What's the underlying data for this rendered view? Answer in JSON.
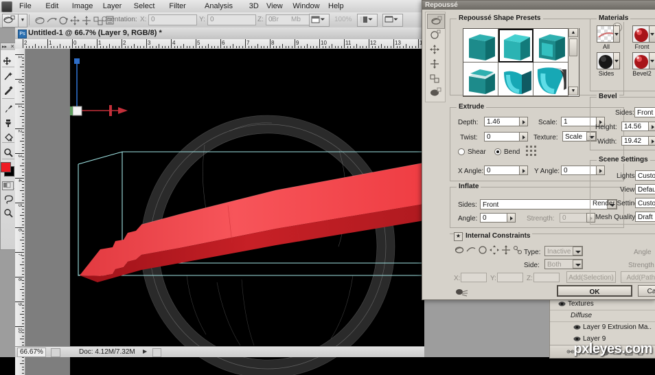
{
  "menubar": {
    "logo_icon": "photoshop-logo-icon",
    "items": [
      "File",
      "Edit",
      "Image",
      "Layer",
      "Select",
      "Filter",
      "Analysis",
      "3D",
      "View",
      "Window",
      "Help"
    ],
    "right_controls": [
      "bridge-icon",
      "minibridge-icon"
    ]
  },
  "options_bar": {
    "tool_icon": "3d-object-rotate-tool-icon",
    "tool_caret": "▼",
    "mode_icons": [
      "3d-rotate-icon",
      "3d-roll-icon",
      "3d-pan-icon",
      "3d-slide-icon",
      "3d-scale-icon",
      "3d-mesh-icon"
    ],
    "orientation_label": "Orientation:",
    "x_label": "X:",
    "x_value": "0",
    "y_label": "Y:",
    "y_value": "0",
    "z_label": "Z:",
    "z_value": "0",
    "right_icons": [
      "doc-arrange-icon",
      "screen-mode-icon",
      "extras-icon"
    ],
    "right_zoom": "100%",
    "right_gray_labels": [
      "Br",
      "Mb"
    ]
  },
  "toolbox": {
    "collapse_icon": "▸▸",
    "close_icon": "✕",
    "tools": [
      {
        "name": "move-tool",
        "icon": "move-icon"
      },
      {
        "name": "magic-wand-tool",
        "icon": "magic-wand-icon"
      },
      {
        "name": "eyedropper-tool",
        "icon": "eyedropper-icon"
      },
      {
        "name": "brush-tool",
        "icon": "brush-icon"
      },
      {
        "name": "clone-stamp-tool",
        "icon": "clone-stamp-icon"
      },
      {
        "name": "paint-bucket-tool",
        "icon": "paint-bucket-icon"
      },
      {
        "name": "dodge-burn-tool",
        "icon": "burn-icon"
      },
      {
        "name": "type-tool",
        "icon": "type-t-icon"
      },
      {
        "name": "shape-tool",
        "icon": "rectangle-shape-icon"
      },
      {
        "name": "lasso-tool",
        "icon": "lasso-icon"
      },
      {
        "name": "zoom-tool",
        "icon": "magnifier-icon"
      }
    ],
    "foreground_color": "#ee1b24",
    "background_color": "#000000",
    "quickmask_icon": "quick-mask-icon"
  },
  "document": {
    "badge": "Ps",
    "title": "Untitled-1 @ 66.7% (Layer 9, RGB/8) *",
    "ruler_h_marks": [
      "2",
      "1",
      "0",
      "1",
      "2",
      "3",
      "4",
      "5",
      "6",
      "7",
      "8",
      "9",
      "10",
      "11",
      "12",
      "13",
      "14"
    ],
    "ruler_v_marks": [
      "1",
      "0",
      "1",
      "2",
      "3",
      "4",
      "5",
      "6",
      "7",
      "8",
      "9",
      "10",
      "11"
    ],
    "canvas_background": "#000000",
    "artwork": {
      "bounding_box_color": "#9fe3e3",
      "extrusion_color_light": "#f4454a",
      "extrusion_color_dark": "#a5151c",
      "ring_color": "#232323",
      "axis_y_color": "#2e6ec9",
      "axis_x_color": "#c4303a"
    }
  },
  "status_bar": {
    "zoom": "66.67%",
    "doc_icon": "doc-preview-icon",
    "doc_info": "Doc: 4.12M/7.32M",
    "arrow": "▶"
  },
  "dialog": {
    "title": "Repoussé",
    "side_tools": [
      {
        "name": "repousse-mesh-tool",
        "icon": "mesh-rotate-icon",
        "selected": true
      },
      {
        "name": "repousse-roll-tool",
        "icon": "roll-icon",
        "selected": false
      },
      {
        "name": "repousse-pan-tool",
        "icon": "pan-icon",
        "selected": false
      },
      {
        "name": "repousse-slide-tool",
        "icon": "slide-icon",
        "selected": false
      },
      {
        "name": "repousse-scale-tool",
        "icon": "scale-icon",
        "selected": false
      },
      {
        "name": "repousse-camera-tool",
        "icon": "camera-icon",
        "selected": false
      }
    ],
    "presets": {
      "group_label": "Repoussé Shape Presets",
      "flyout_icon": "flyout-menu-icon",
      "items": [
        {
          "name": "preset-bevel-none",
          "selected": false
        },
        {
          "name": "preset-inflate-front",
          "selected": true
        },
        {
          "name": "preset-inflate-sides",
          "selected": false
        },
        {
          "name": "preset-bevel-ring",
          "selected": false
        },
        {
          "name": "preset-cone-short",
          "selected": false
        },
        {
          "name": "preset-cone-twist",
          "selected": false
        }
      ],
      "scroll_up": "▲",
      "scroll_down": "▼"
    },
    "extrude": {
      "group_label": "Extrude",
      "depth_label": "Depth:",
      "depth_value": "1.46",
      "scale_label": "Scale:",
      "scale_value": "1",
      "twist_label": "Twist:",
      "twist_value": "0",
      "texture_label": "Texture:",
      "texture_value": "Scale",
      "shear_label": "Shear",
      "bend_label": "Bend",
      "bend_selected": true,
      "constraint_icon": "bend-grid-icon",
      "x_angle_label": "X Angle:",
      "x_angle_value": "0",
      "y_angle_label": "Y Angle:",
      "y_angle_value": "0"
    },
    "inflate": {
      "group_label": "Inflate",
      "sides_label": "Sides:",
      "sides_value": "Front",
      "angle_label": "Angle:",
      "angle_value": "0",
      "strength_label": "Strength:",
      "strength_value": "0",
      "strength_disabled": true
    },
    "internal_constraints": {
      "group_label": "Internal Constraints",
      "expand_icon": "expand-collapse-icon",
      "tool_icons": [
        "constraint-rotate-icon",
        "constraint-roll-icon",
        "constraint-pan-icon",
        "constraint-slide-icon",
        "constraint-scale-icon",
        "constraint-mesh-icon"
      ],
      "type_label": "Type:",
      "type_value": "Inactive",
      "side_label": "Side:",
      "side_value": "Both",
      "angle_label": "Angle",
      "strength_label": "Strength",
      "x_label": "X:",
      "x_value": "",
      "y_label": "Y:",
      "y_value": "",
      "z_label": "Z:",
      "z_value": "",
      "add_selection_label": "Add(Selection)",
      "add_path_label": "Add(Path)",
      "bottom_icon": "constraint-preview-icon"
    },
    "materials": {
      "group_label": "Materials",
      "items": [
        {
          "name": "material-all",
          "label": "All",
          "swatch": "checker"
        },
        {
          "name": "material-front",
          "label": "Front",
          "swatch": "red"
        },
        {
          "name": "material-sides",
          "label": "Sides",
          "swatch": "black"
        },
        {
          "name": "material-bevel2",
          "label": "Bevel2",
          "swatch": "red"
        }
      ]
    },
    "bevel": {
      "group_label": "Bevel",
      "sides_label": "Sides:",
      "sides_value": "Front",
      "height_label": "Height:",
      "height_value": "14.56",
      "width_label": "Width:",
      "width_value": "19.42"
    },
    "scene_settings": {
      "group_label": "Scene Settings",
      "lights_label": "Lights:",
      "lights_value": "Custom",
      "view_label": "View:",
      "view_value": "Default",
      "render_label": "Render Settings:",
      "render_value": "Custom",
      "mesh_label": "Mesh Quality:",
      "mesh_value": "Draft"
    },
    "buttons": {
      "ok_label": "OK",
      "cancel_label": "Ca"
    }
  },
  "layers_panel": {
    "rows": [
      {
        "name": "layer-textures-group",
        "label": "Textures",
        "eye": true,
        "italic": false,
        "indent": 26
      },
      {
        "name": "layer-diffuse-group",
        "label": "Diffuse",
        "eye": false,
        "italic": true,
        "indent": 30
      },
      {
        "name": "layer-9-extrusion",
        "label": "Layer 9 Extrusion Ma..",
        "eye": true,
        "italic": false,
        "indent": 48
      },
      {
        "name": "layer-9",
        "label": "Layer 9",
        "eye": true,
        "italic": false,
        "indent": 48
      }
    ],
    "footer_icons": [
      "link-icon",
      "fx-icon",
      "mask-icon",
      "adjustment-icon",
      "group-icon",
      "new-layer-icon",
      "delete-icon"
    ]
  },
  "watermark": {
    "text": "pxleyes.com"
  }
}
